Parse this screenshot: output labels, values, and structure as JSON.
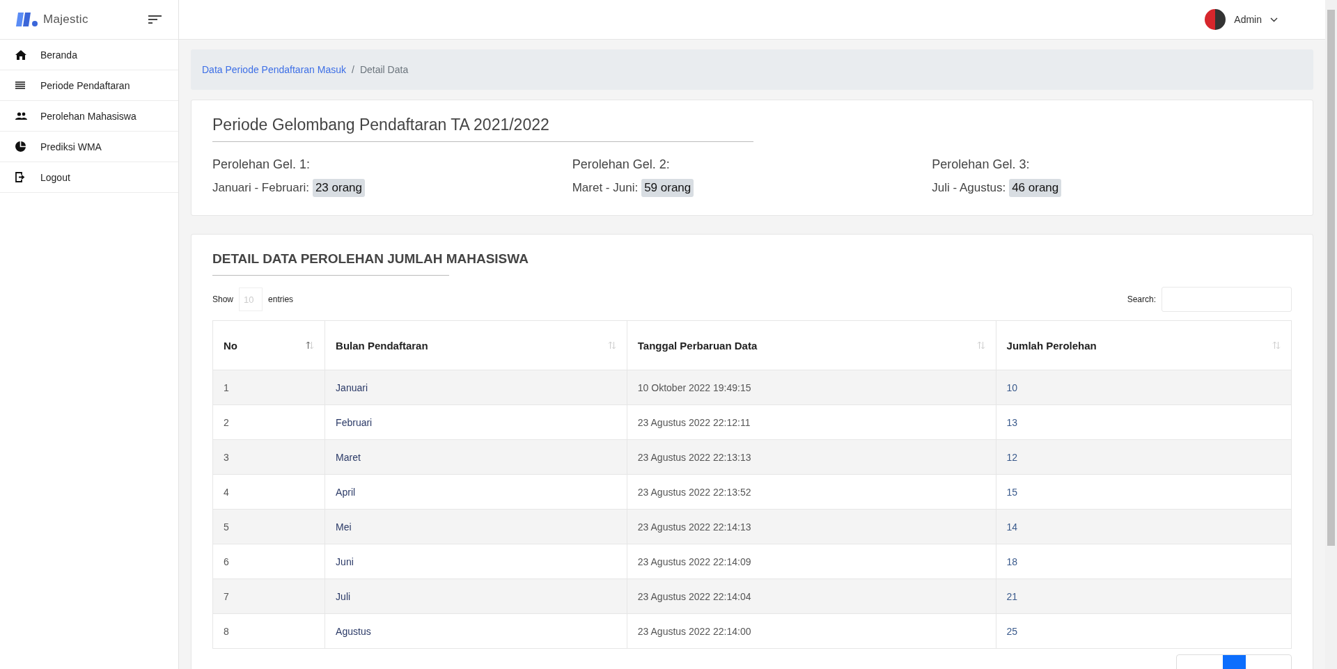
{
  "brand": {
    "name": "Majestic"
  },
  "user": {
    "name": "Admin"
  },
  "sidebar": {
    "items": [
      {
        "label": "Beranda",
        "kind": "home"
      },
      {
        "label": "Periode Pendaftaran",
        "kind": "list"
      },
      {
        "label": "Perolehan Mahasiswa",
        "kind": "people"
      },
      {
        "label": "Prediksi WMA",
        "kind": "chart"
      },
      {
        "label": "Logout",
        "kind": "logout"
      }
    ]
  },
  "breadcrumb": {
    "separator": "/",
    "items": [
      {
        "label": "Data Periode Pendaftaran Masuk",
        "kind": "link"
      },
      {
        "label": "Detail Data",
        "kind": "current"
      }
    ]
  },
  "summary": {
    "title": "Periode Gelombang Pendaftaran TA 2021/2022",
    "waves": [
      {
        "heading": "Perolehan Gel. 1:",
        "range": "Januari - Februari:",
        "count": "23 orang"
      },
      {
        "heading": "Perolehan Gel. 2:",
        "range": "Maret - Juni:",
        "count": "59 orang"
      },
      {
        "heading": "Perolehan Gel. 3:",
        "range": "Juli - Agustus:",
        "count": "46 orang"
      }
    ]
  },
  "detail": {
    "title": "DETAIL DATA PEROLEHAN JUMLAH MAHASISWA",
    "show_label": "Show",
    "entries_value": "10",
    "entries_label": "entries",
    "search_label": "Search:",
    "table": {
      "columns": [
        {
          "label": "No",
          "sorted": true
        },
        {
          "label": "Bulan Pendaftaran",
          "sorted": false
        },
        {
          "label": "Tanggal Perbaruan Data",
          "sorted": false
        },
        {
          "label": "Jumlah Perolehan",
          "sorted": false
        }
      ],
      "rows": [
        [
          "1",
          "Januari",
          "10 Oktober 2022 19:49:15",
          "10"
        ],
        [
          "2",
          "Februari",
          "23 Agustus 2022 22:12:11",
          "13"
        ],
        [
          "3",
          "Maret",
          "23 Agustus 2022 22:13:13",
          "12"
        ],
        [
          "4",
          "April",
          "23 Agustus 2022 22:13:52",
          "15"
        ],
        [
          "5",
          "Mei",
          "23 Agustus 2022 22:14:13",
          "14"
        ],
        [
          "6",
          "Juni",
          "23 Agustus 2022 22:14:09",
          "18"
        ],
        [
          "7",
          "Juli",
          "23 Agustus 2022 22:14:04",
          "21"
        ],
        [
          "8",
          "Agustus",
          "23 Agustus 2022 22:14:00",
          "25"
        ]
      ]
    }
  }
}
